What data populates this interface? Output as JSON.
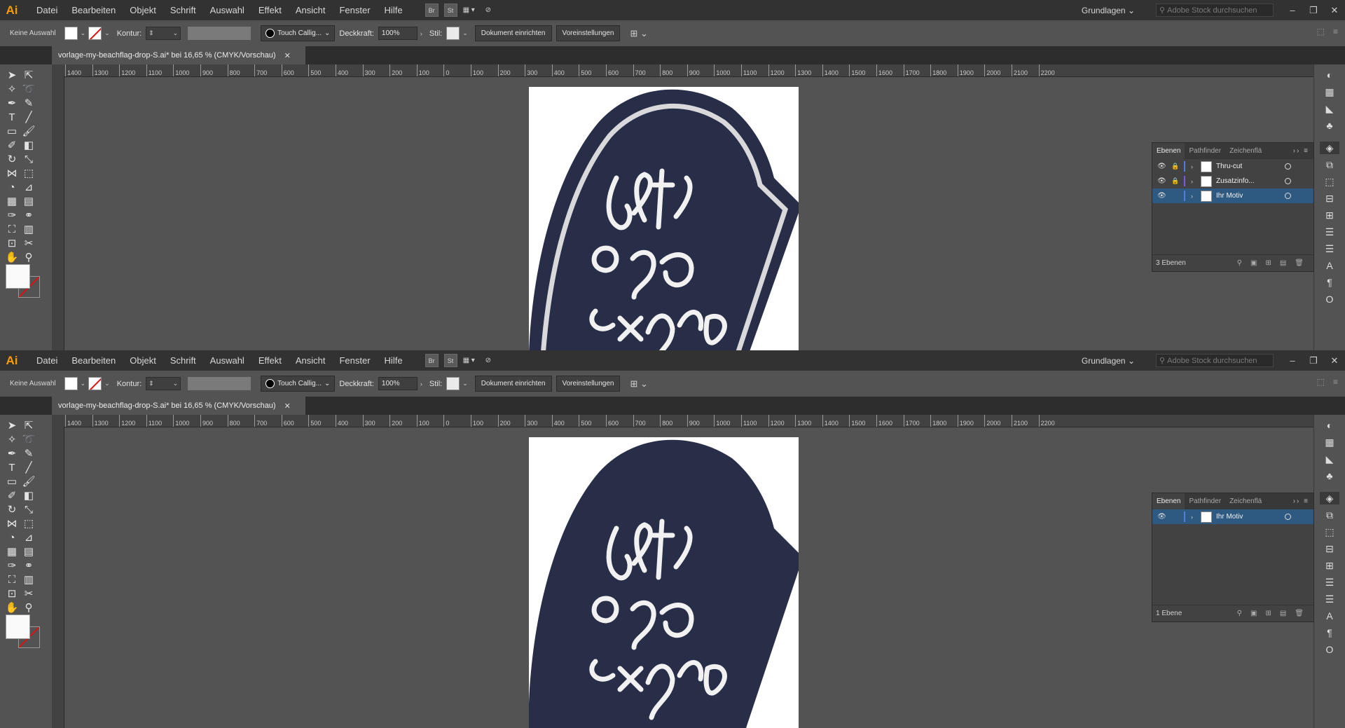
{
  "app": {
    "logo": "Ai"
  },
  "menu": [
    "Datei",
    "Bearbeiten",
    "Objekt",
    "Schrift",
    "Auswahl",
    "Effekt",
    "Ansicht",
    "Fenster",
    "Hilfe"
  ],
  "menu_icons": {
    "bridge": "Br",
    "stock": "St"
  },
  "workspace": "Grundlagen",
  "stock_search_placeholder": "Adobe Stock durchsuchen",
  "control": {
    "selection": "Keine Auswahl",
    "stroke_label": "Kontur:",
    "brush_name": "Touch Callig...",
    "opacity_label": "Deckkraft:",
    "opacity_value": "100%",
    "style_label": "Stil:",
    "doc_setup_button": "Dokument einrichten",
    "preferences_button": "Voreinstellungen"
  },
  "document_tab": "vorlage-my-beachflag-drop-S.ai* bei 16,65 % (CMYK/Vorschau)",
  "ruler_labels": [
    "1400",
    "1300",
    "1200",
    "1100",
    "1000",
    "900",
    "800",
    "700",
    "600",
    "500",
    "400",
    "300",
    "200",
    "100",
    "0",
    "100",
    "200",
    "300",
    "400",
    "500",
    "600",
    "700",
    "800",
    "900",
    "1000",
    "1100",
    "1200",
    "1300",
    "1400",
    "1500",
    "1600",
    "1700",
    "1800",
    "1900",
    "2000",
    "2100",
    "2200"
  ],
  "panel_tabs": [
    "Ebenen",
    "Pathfinder",
    "Zeichenflä"
  ],
  "instance1": {
    "layers": [
      {
        "name": "Thru-cut",
        "color": "#4f7fd9",
        "locked": true,
        "selected": false
      },
      {
        "name": "Zusatzinfo...",
        "color": "#7a5bd6",
        "locked": true,
        "selected": false
      },
      {
        "name": "Ihr Motiv",
        "color": "#4f7fd9",
        "locked": false,
        "selected": true
      }
    ],
    "layer_count": "3 Ebenen"
  },
  "instance2": {
    "layers": [
      {
        "name": "Ihr Motiv",
        "color": "#4f7fd9",
        "locked": false,
        "selected": true
      }
    ],
    "layer_count": "1 Ebene"
  },
  "colors": {
    "flag_navy": "#282d48",
    "accent_orange": "#ff9a00",
    "selection_blue": "#2e5a82"
  }
}
